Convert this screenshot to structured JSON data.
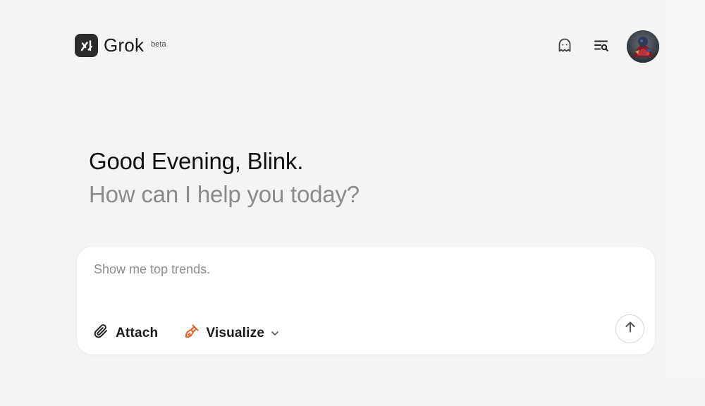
{
  "header": {
    "brand_name": "Grok",
    "brand_tag": "beta",
    "icons": [
      "logo-icon",
      "ghost-icon",
      "history-search-icon",
      "avatar"
    ]
  },
  "main": {
    "greeting": "Good Evening, Blink.",
    "subgreeting": "How can I help you today?"
  },
  "composer": {
    "placeholder": "Show me top trends.",
    "value": "",
    "attach_label": "Attach",
    "visualize_label": "Visualize",
    "icons": [
      "paperclip-icon",
      "paintbrush-icon",
      "chevron-down-icon",
      "arrow-up-icon"
    ]
  },
  "colors": {
    "background": "#f4f4f4",
    "text_primary": "#111111",
    "text_secondary": "#8a8a8a",
    "accent_orange": "#e8622c",
    "logo_bg": "#2b2b2b"
  }
}
